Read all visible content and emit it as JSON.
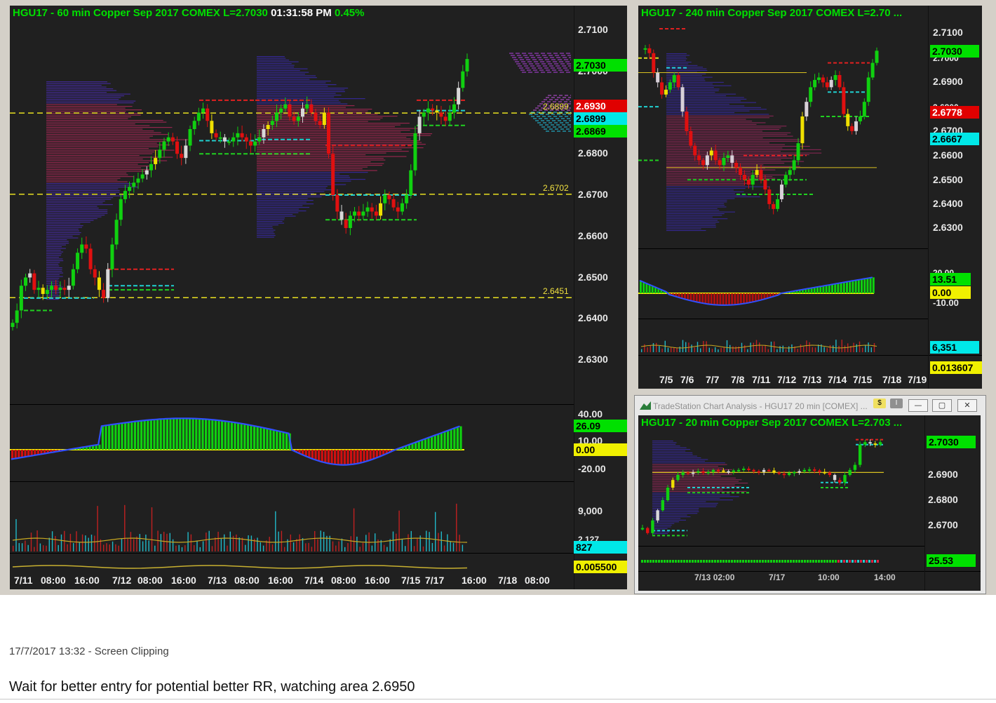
{
  "main_chart": {
    "title_prefix": "HGU17 - 60 min  Copper Sep 2017  COMEX  L=2.7030",
    "title_time": "01:31:58 PM",
    "title_change": "0.45%",
    "price_axis": [
      "2.7100",
      "2.7000",
      "2.6900",
      "2.6800",
      "2.6700",
      "2.6600",
      "2.6500",
      "2.6400",
      "2.6300"
    ],
    "price_tags": [
      {
        "value": "2.7030",
        "bg": "#00e000",
        "fg": "#000000"
      },
      {
        "value": "2.6930",
        "bg": "#e00000",
        "fg": "#ffffff"
      },
      {
        "value": "2.6899",
        "bg": "#00e8e8",
        "fg": "#000000"
      },
      {
        "value": "2.6869",
        "bg": "#00e000",
        "fg": "#000000"
      }
    ],
    "level_labels": [
      "2.6899",
      "2.6702",
      "2.6451"
    ],
    "osc_axis": [
      "40.00",
      "10.00",
      "-20.00"
    ],
    "osc_tags": [
      {
        "value": "26.09",
        "bg": "#00e000",
        "fg": "#000000"
      },
      {
        "value": "0.00",
        "bg": "#f0f000",
        "fg": "#000000"
      }
    ],
    "vol_axis": [
      "9,000",
      "2,127"
    ],
    "vol_tags": [
      {
        "value": "827",
        "bg": "#00e8e8",
        "fg": "#000000"
      },
      {
        "value": "0.005500",
        "bg": "#f0f000",
        "fg": "#000000"
      }
    ],
    "dates": [
      "7/11",
      "08:00",
      "16:00",
      "7/12",
      "08:00",
      "16:00",
      "7/13",
      "08:00",
      "16:00",
      "7/14",
      "08:00",
      "16:00",
      "7/15",
      "7/17",
      "16:00",
      "7/18",
      "08:00"
    ]
  },
  "chart_240": {
    "title": "HGU17 - 240 min  Copper Sep 2017  COMEX  L=2.70 ...",
    "price_axis": [
      "2.7100",
      "2.7000",
      "2.6900",
      "2.6800",
      "2.6700",
      "2.6600",
      "2.6500",
      "2.6400",
      "2.6300"
    ],
    "price_tags": [
      {
        "value": "2.7030",
        "bg": "#00e000",
        "fg": "#000000"
      },
      {
        "value": "2.6778",
        "bg": "#e00000",
        "fg": "#ffffff"
      },
      {
        "value": "2.6667",
        "bg": "#00e8e8",
        "fg": "#000000"
      }
    ],
    "osc_axis": [
      "20.00",
      "-10.00"
    ],
    "osc_tags": [
      {
        "value": "13.51",
        "bg": "#00e000",
        "fg": "#000000"
      },
      {
        "value": "0.00",
        "bg": "#f0f000",
        "fg": "#000000"
      }
    ],
    "vol_tags": [
      {
        "value": "6,351",
        "bg": "#00e8e8",
        "fg": "#000000"
      },
      {
        "value": "0.013607",
        "bg": "#f0f000",
        "fg": "#000000"
      }
    ],
    "dates": [
      "7/5",
      "7/6",
      "7/7",
      "7/8",
      "7/11",
      "7/12",
      "7/13",
      "7/14",
      "7/15",
      "7/18",
      "7/19"
    ]
  },
  "window_20": {
    "window_title": "TradeStation Chart Analysis - HGU17 20 min [COMEX] ...",
    "title": "HGU17 - 20 min  Copper Sep 2017  COMEX  L=2.703 ...",
    "price_axis": [
      "2.6900",
      "2.6800",
      "2.6700"
    ],
    "price_tags": [
      {
        "value": "2.7030",
        "bg": "#00e000",
        "fg": "#000000"
      }
    ],
    "osc_tags": [
      {
        "value": "25.53",
        "bg": "#00e000",
        "fg": "#000000"
      }
    ],
    "dates": [
      "7/13 02:00",
      "7/17",
      "10:00",
      "14:00"
    ],
    "btn_min": "—",
    "btn_max": "▢",
    "btn_close": "✕",
    "dollar_badge": "$",
    "info_badge": "I"
  },
  "caption": "17/7/2017 13:32 - Screen Clipping",
  "note": "Wait for better entry for potential better RR, watching area 2.6950"
}
